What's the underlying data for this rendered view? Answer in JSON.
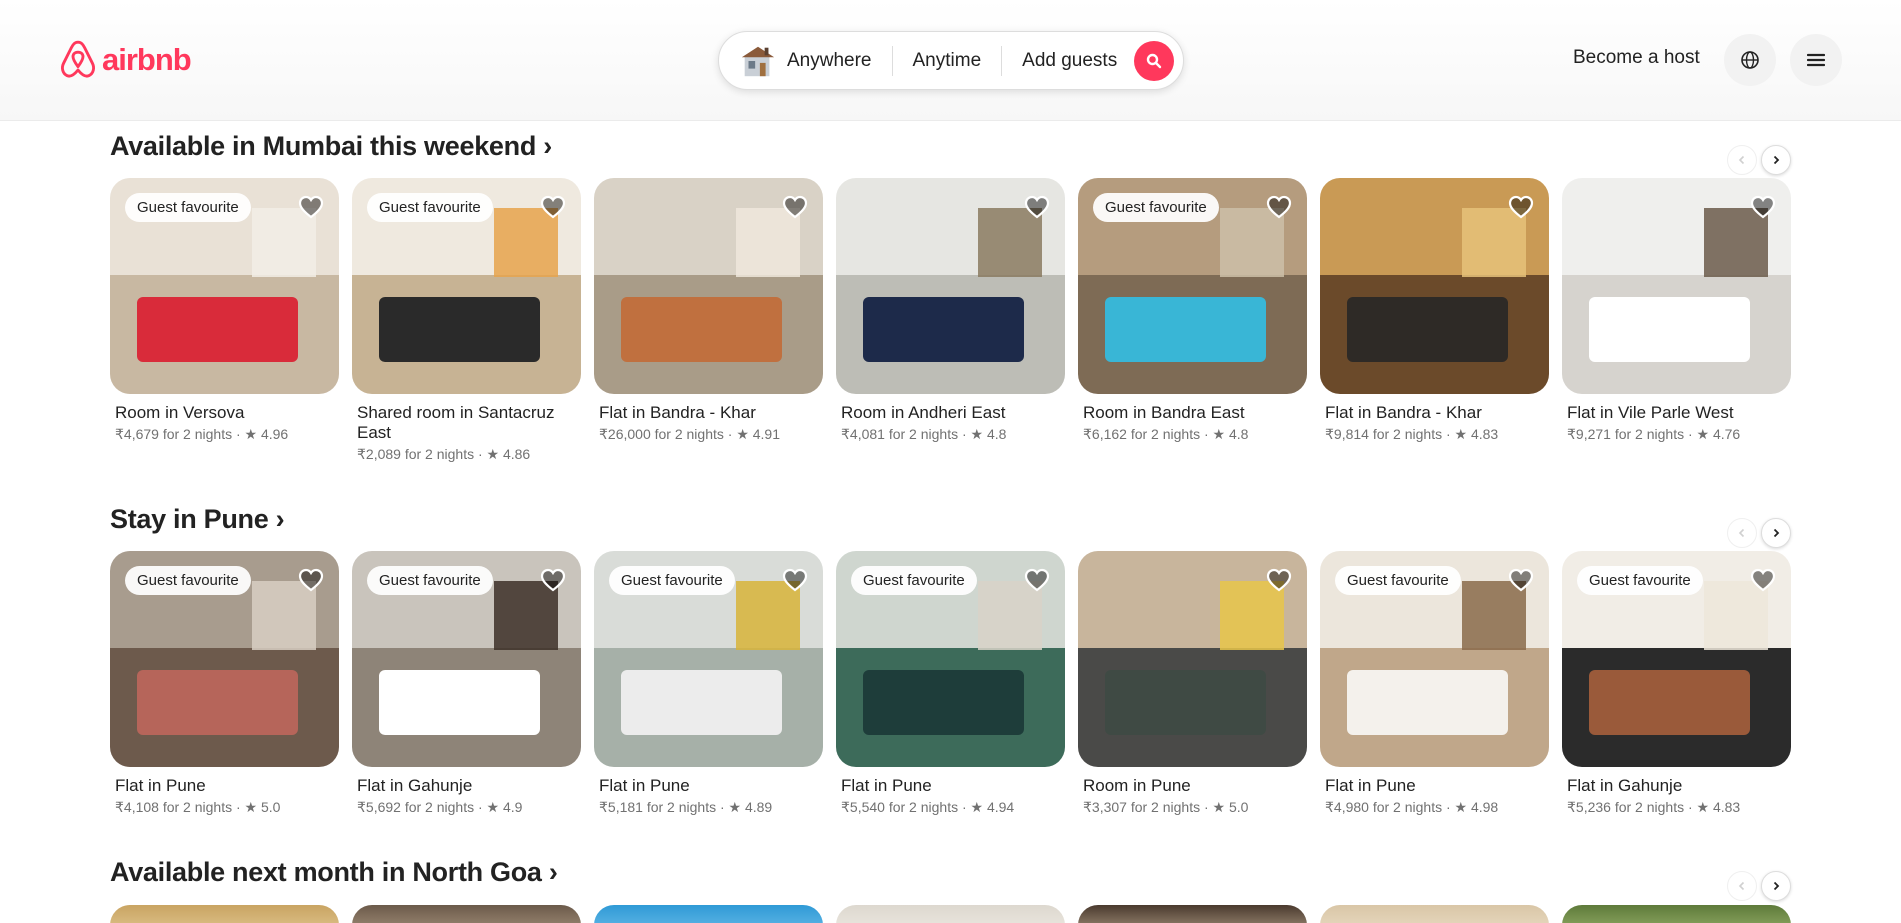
{
  "header": {
    "logo_text": "airbnb",
    "search": {
      "where": "Anywhere",
      "when": "Anytime",
      "who": "Add guests"
    },
    "become_host": "Become a host"
  },
  "colors": {
    "brand": "#FF385C",
    "text": "#222222",
    "muted": "#717171"
  },
  "sections": [
    {
      "title": "Available in Mumbai this weekend ›",
      "cards": [
        {
          "badge": "Guest favourite",
          "title": "Room in Versova",
          "sub": "₹4,679 for 2 nights · ★ 4.96"
        },
        {
          "badge": "Guest favourite",
          "title": "Shared room in Santacruz East",
          "sub": "₹2,089 for 2 nights · ★ 4.86"
        },
        {
          "badge": "",
          "title": "Flat in Bandra - Khar",
          "sub": "₹26,000 for 2 nights · ★ 4.91"
        },
        {
          "badge": "",
          "title": "Room in Andheri East",
          "sub": "₹4,081 for 2 nights · ★ 4.8"
        },
        {
          "badge": "Guest favourite",
          "title": "Room in Bandra East",
          "sub": "₹6,162 for 2 nights · ★ 4.8"
        },
        {
          "badge": "",
          "title": "Flat in Bandra - Khar",
          "sub": "₹9,814 for 2 nights · ★ 4.83"
        },
        {
          "badge": "",
          "title": "Flat in Vile Parle West",
          "sub": "₹9,271 for 2 nights · ★ 4.76"
        }
      ]
    },
    {
      "title": "Stay in Pune ›",
      "cards": [
        {
          "badge": "Guest favourite",
          "title": "Flat in Pune",
          "sub": "₹4,108 for 2 nights · ★ 5.0"
        },
        {
          "badge": "Guest favourite",
          "title": "Flat in Gahunje",
          "sub": "₹5,692 for 2 nights · ★ 4.9"
        },
        {
          "badge": "Guest favourite",
          "title": "Flat in Pune",
          "sub": "₹5,181 for 2 nights · ★ 4.89"
        },
        {
          "badge": "Guest favourite",
          "title": "Flat in Pune",
          "sub": "₹5,540 for 2 nights · ★ 4.94"
        },
        {
          "badge": "",
          "title": "Room in Pune",
          "sub": "₹3,307 for 2 nights · ★ 5.0"
        },
        {
          "badge": "Guest favourite",
          "title": "Flat in Pune",
          "sub": "₹4,980 for 2 nights · ★ 4.98"
        },
        {
          "badge": "Guest favourite",
          "title": "Flat in Gahunje",
          "sub": "₹5,236 for 2 nights · ★ 4.83"
        }
      ]
    },
    {
      "title": "Available next month in North Goa ›",
      "cards": []
    }
  ]
}
